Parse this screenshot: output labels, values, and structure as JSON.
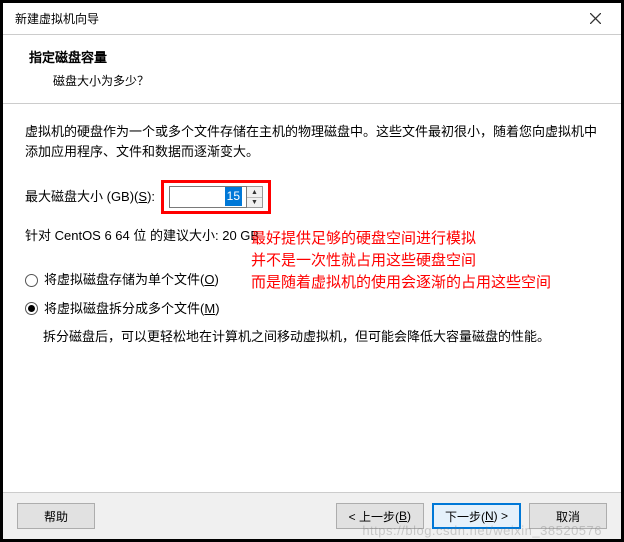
{
  "window": {
    "title": "新建虚拟机向导"
  },
  "header": {
    "title": "指定磁盘容量",
    "subtitle": "磁盘大小为多少？"
  },
  "content": {
    "description": "虚拟机的硬盘作为一个或多个文件存储在主机的物理磁盘中。这些文件最初很小，随着您向虚拟机中添加应用程序、文件和数据而逐渐变大。",
    "size_label_pre": "最大磁盘大小 (GB)(",
    "size_label_mn": "S",
    "size_label_post": "):",
    "size_value": "15",
    "recommended": "针对 CentOS 6 64 位 的建议大小: 20 GB",
    "radio1_pre": "将虚拟磁盘存储为单个文件(",
    "radio1_mn": "O",
    "radio1_post": ")",
    "radio2_pre": "将虚拟磁盘拆分成多个文件(",
    "radio2_mn": "M",
    "radio2_post": ")",
    "hint": "拆分磁盘后，可以更轻松地在计算机之间移动虚拟机，但可能会降低大容量磁盘的性能。"
  },
  "annotation": {
    "text": "最好提供足够的硬盘空间进行模拟\n并不是一次性就占用这些硬盘空间\n而是随着虚拟机的使用会逐渐的占用这些空间"
  },
  "footer": {
    "help": "帮助",
    "back_pre": "< 上一步(",
    "back_mn": "B",
    "back_post": ")",
    "next_pre": "下一步(",
    "next_mn": "N",
    "next_post": ") >",
    "cancel": "取消"
  },
  "watermark": "https://blog.csdn.net/weixin_38520576"
}
